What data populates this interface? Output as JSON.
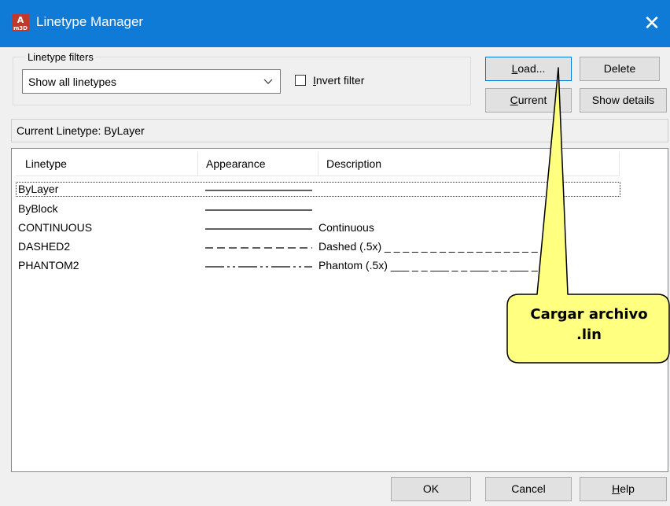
{
  "window": {
    "title": "Linetype Manager",
    "app_icon": "autocad-m3d-icon",
    "title_bar_color": "#0f7bd6"
  },
  "filters": {
    "group_label": "Linetype filters",
    "selected": "Show all linetypes",
    "invert_label": "Invert filter",
    "invert_checked": false
  },
  "buttons": {
    "load": "Load...",
    "delete": "Delete",
    "current": "Current",
    "show_details": "Show details",
    "ok": "OK",
    "cancel": "Cancel",
    "help": "Help"
  },
  "current_linetype": "Current Linetype:  ByLayer",
  "columns": [
    "Linetype",
    "Appearance",
    "Description"
  ],
  "rows": [
    {
      "name": "ByLayer",
      "appearance": "solid",
      "description": ""
    },
    {
      "name": "ByBlock",
      "appearance": "solid",
      "description": ""
    },
    {
      "name": "CONTINUOUS",
      "appearance": "solid",
      "description": "Continuous"
    },
    {
      "name": "DASHED2",
      "appearance": "dashed",
      "description": "Dashed (.5x) _ _ _ _ _ _ _ _ _ _ _ _ _ _ _ _ _ _ _"
    },
    {
      "name": "PHANTOM2",
      "appearance": "phantom",
      "description": "Phantom (.5x) ___ _ _ ___ _ _ ___ _ _ ___ _ _ __"
    }
  ],
  "callout": {
    "text_line1": "Cargar archivo",
    "text_line2": ".lin",
    "fill": "#ffff80"
  }
}
